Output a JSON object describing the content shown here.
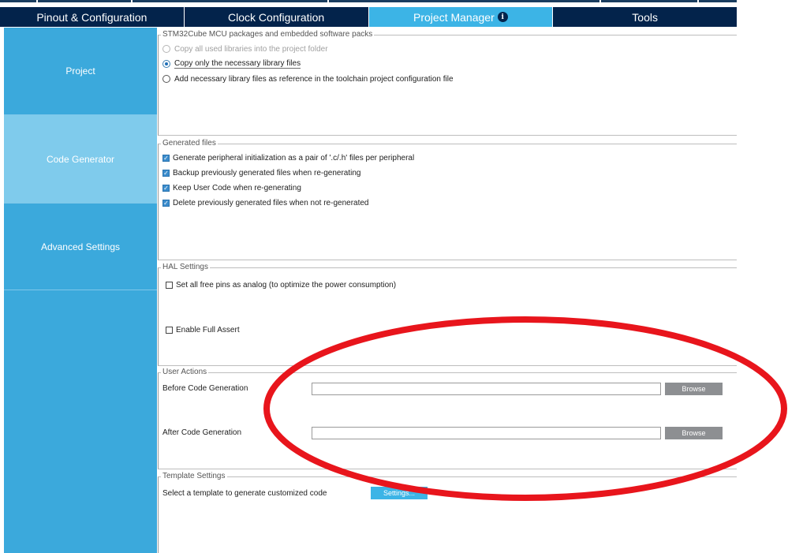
{
  "tabs": [
    {
      "label": "Pinout & Configuration",
      "active": false
    },
    {
      "label": "Clock Configuration",
      "active": false
    },
    {
      "label": "Project Manager",
      "active": true,
      "icon": "info-icon"
    },
    {
      "label": "Tools",
      "active": false
    }
  ],
  "sidebar": {
    "items": [
      {
        "label": "Project",
        "active": false
      },
      {
        "label": "Code Generator",
        "active": true
      },
      {
        "label": "Advanced Settings",
        "active": false
      }
    ]
  },
  "packages": {
    "legend": "STM32Cube MCU packages and embedded software packs",
    "options": [
      {
        "label": "Copy all used libraries into the project folder",
        "selected": false,
        "disabled": true
      },
      {
        "label": "Copy only the necessary library files",
        "selected": true,
        "disabled": false
      },
      {
        "label": "Add necessary library files as reference in the toolchain project configuration file",
        "selected": false,
        "disabled": false
      }
    ]
  },
  "generated_files": {
    "legend": "Generated files",
    "options": [
      {
        "label": "Generate peripheral initialization as a pair of '.c/.h' files per peripheral",
        "checked": true
      },
      {
        "label": "Backup previously generated files when re-generating",
        "checked": true
      },
      {
        "label": "Keep User Code when re-generating",
        "checked": true
      },
      {
        "label": "Delete previously generated files when not re-generated",
        "checked": true
      }
    ]
  },
  "hal_settings": {
    "legend": "HAL Settings",
    "options": [
      {
        "label": "Set all free pins as analog (to optimize the power consumption)",
        "checked": false
      },
      {
        "label": "Enable Full Assert",
        "checked": false
      }
    ]
  },
  "user_actions": {
    "legend": "User Actions",
    "before_label": "Before Code Generation",
    "before_value": "",
    "after_label": "After Code Generation",
    "after_value": "",
    "browse_label": "Browse"
  },
  "template_settings": {
    "legend": "Template Settings",
    "description": "Select a template to generate customized code",
    "button_label": "Settings..."
  },
  "colors": {
    "tab_bar": "#03234b",
    "tab_active": "#3cb4e6",
    "sidebar": "#3ba9dc",
    "sidebar_active": "#7fcbec",
    "annotation": "#e8151c"
  }
}
